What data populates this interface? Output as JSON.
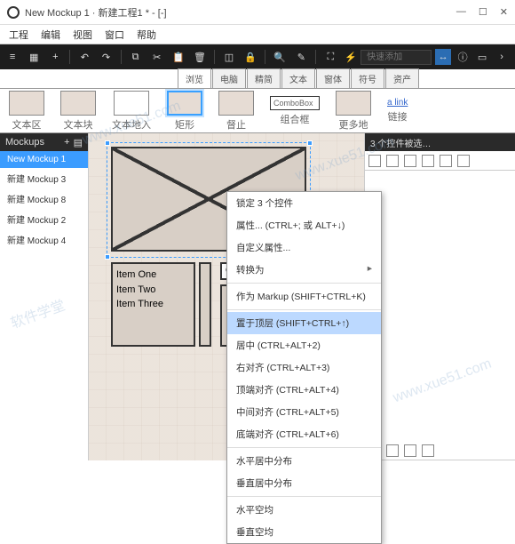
{
  "window": {
    "title": "New Mockup 1 · 新建工程1 * - [-]"
  },
  "menu": {
    "items": [
      "工程",
      "编辑",
      "视图",
      "窗口",
      "帮助"
    ]
  },
  "toolbar": {
    "search_placeholder": "快速添加"
  },
  "tabs": {
    "items": [
      "浏览",
      "电脑",
      "精简",
      "文本",
      "窗体",
      "符号",
      "资产"
    ],
    "active": 0
  },
  "library": {
    "items": [
      {
        "label": "文本区",
        "kind": "box"
      },
      {
        "label": "文本块",
        "kind": "box"
      },
      {
        "label": "文本地入",
        "kind": "plain"
      },
      {
        "label": "矩形",
        "kind": "sel"
      },
      {
        "label": "督止",
        "kind": "box"
      },
      {
        "label": "组合框",
        "kind": "combo",
        "text": "ComboBox"
      },
      {
        "label": "更多地",
        "kind": "box"
      },
      {
        "label": "链接",
        "kind": "link",
        "text": "a link"
      }
    ]
  },
  "sidebar": {
    "title": "Mockups",
    "items": [
      "New Mockup 1",
      "新建 Mockup 3",
      "新建 Mockup 8",
      "新建 Mockup 2",
      "新建 Mockup 4"
    ],
    "selected": 0
  },
  "canvas": {
    "list_items": [
      "Item One",
      "Item Two",
      "Item Three"
    ],
    "combo_text": "ComboBox"
  },
  "rpanel": {
    "header": "3 个控件被选…"
  },
  "context_menu": {
    "items": [
      {
        "label": "锁定 3 个控件"
      },
      {
        "label": "属性... (CTRL+; 或 ALT+↓)"
      },
      {
        "label": "自定义属性..."
      },
      {
        "label": "转换为",
        "arrow": true
      },
      {
        "sep": true
      },
      {
        "label": "作为 Markup (SHIFT+CTRL+K)"
      },
      {
        "sep": true
      },
      {
        "label": "置于顶层 (SHIFT+CTRL+↑)",
        "hl": true
      },
      {
        "label": "居中 (CTRL+ALT+2)"
      },
      {
        "label": "右对齐 (CTRL+ALT+3)"
      },
      {
        "label": "顶端对齐 (CTRL+ALT+4)"
      },
      {
        "label": "中间对齐 (CTRL+ALT+5)"
      },
      {
        "label": "底端对齐 (CTRL+ALT+6)"
      },
      {
        "sep": true
      },
      {
        "label": "水平居中分布"
      },
      {
        "label": "垂直居中分布"
      },
      {
        "sep": true
      },
      {
        "label": "水平空均"
      },
      {
        "label": "垂直空均"
      }
    ]
  },
  "watermarks": [
    "www.xue51.com",
    "软件学堂",
    "www.xue51.com",
    "www.xue51.com"
  ]
}
